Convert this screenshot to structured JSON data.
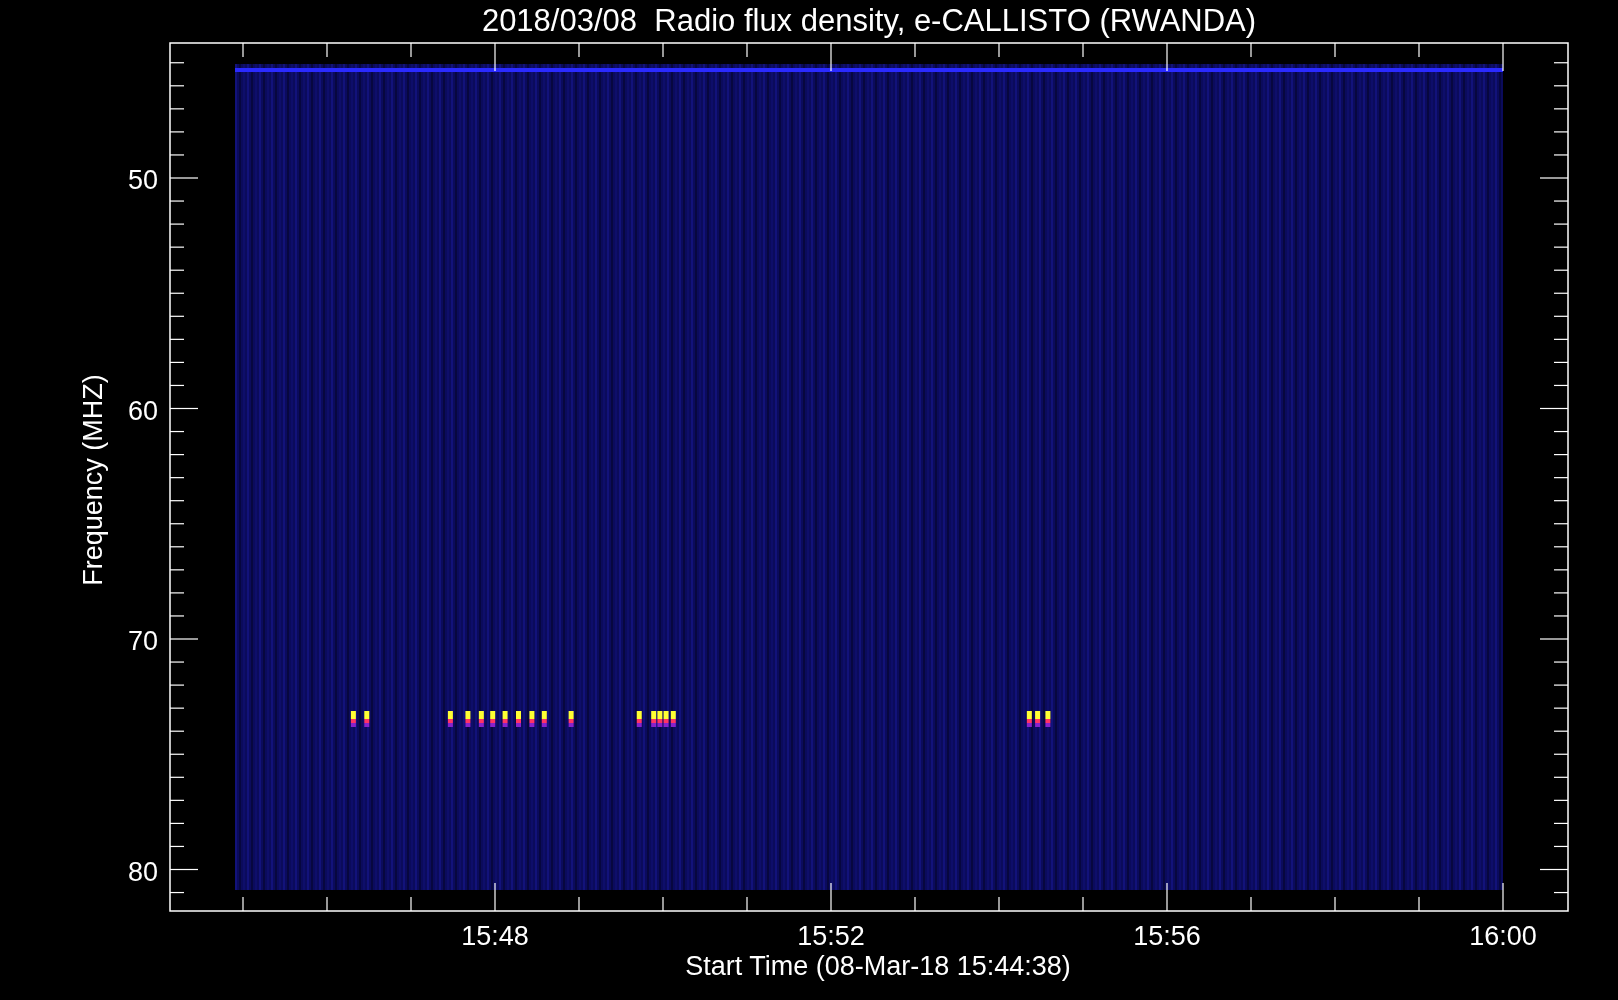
{
  "title": "2018/03/08  Radio flux density, e-CALLISTO (RWANDA)",
  "ylabel": "Frequency (MHZ)",
  "xlabel": "Start Time (08-Mar-18 15:44:38)",
  "yticks": [
    "50",
    "60",
    "70",
    "80"
  ],
  "xticks": [
    "15:48",
    "15:52",
    "15:56",
    "16:00"
  ]
}
